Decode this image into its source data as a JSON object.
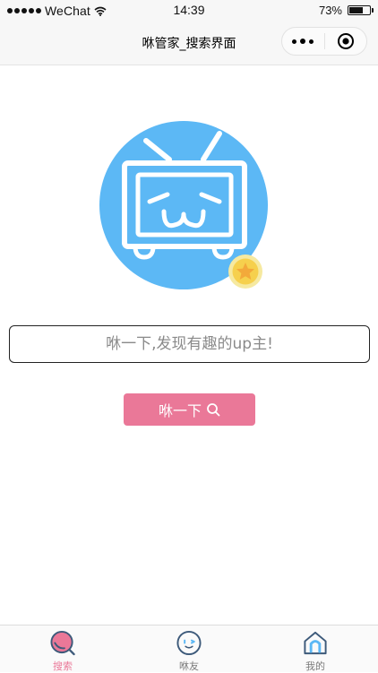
{
  "status_bar": {
    "carrier": "WeChat",
    "time": "14:39",
    "battery_percent": "73%",
    "battery_level": 0.73
  },
  "nav": {
    "title": "咻管家_搜索界面"
  },
  "search": {
    "placeholder": "咻一下,发现有趣的up主!",
    "value": ""
  },
  "search_button": {
    "label": "咻一下"
  },
  "tabs": [
    {
      "label": "搜索",
      "icon": "search-tab-icon",
      "active": true
    },
    {
      "label": "咻友",
      "icon": "friends-tab-icon",
      "active": false
    },
    {
      "label": "我的",
      "icon": "home-tab-icon",
      "active": false
    }
  ],
  "colors": {
    "accent": "#ea7898",
    "logo_blue": "#5cb8f5",
    "badge_gold": "#f6d04d"
  }
}
